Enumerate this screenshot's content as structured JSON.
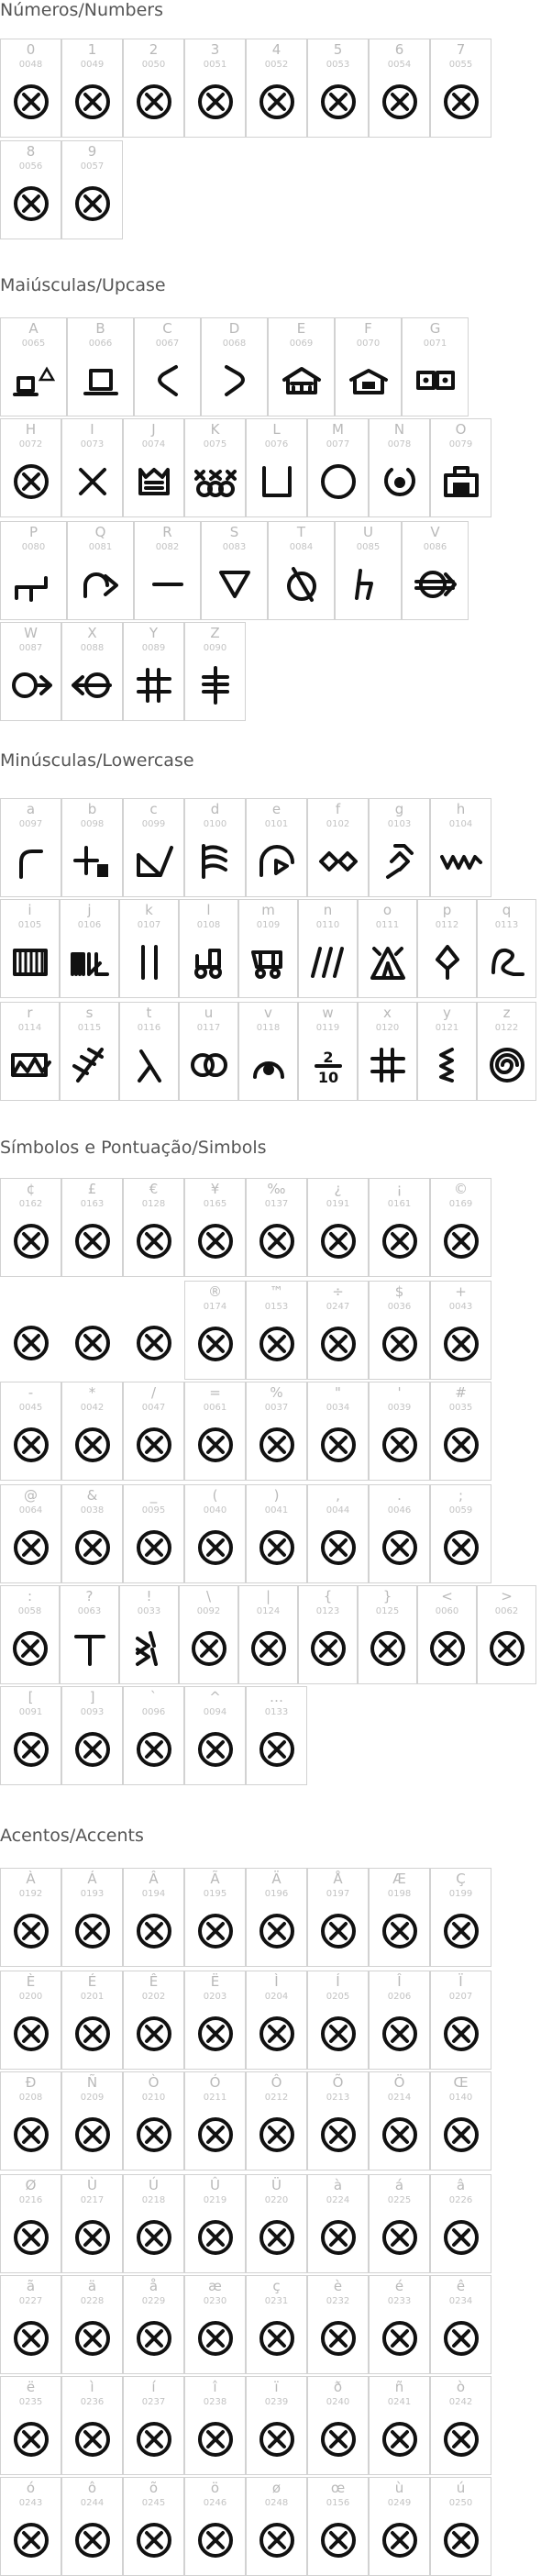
{
  "colors": {
    "border": "#d2d2d2",
    "glyph": "#111111",
    "label": "#b9b9b9",
    "title": "#555555"
  },
  "sections": [
    {
      "title": "Números/Numbers",
      "rows": [
        [
          {
            "ch": "0",
            "code": "0048",
            "g": "x"
          },
          {
            "ch": "1",
            "code": "0049",
            "g": "x"
          },
          {
            "ch": "2",
            "code": "0050",
            "g": "x"
          },
          {
            "ch": "3",
            "code": "0051",
            "g": "x"
          },
          {
            "ch": "4",
            "code": "0052",
            "g": "x"
          },
          {
            "ch": "5",
            "code": "0053",
            "g": "x"
          },
          {
            "ch": "6",
            "code": "0054",
            "g": "x"
          },
          {
            "ch": "7",
            "code": "0055",
            "g": "x"
          }
        ],
        [
          {
            "ch": "8",
            "code": "0056",
            "g": "x"
          },
          {
            "ch": "9",
            "code": "0057",
            "g": "x"
          }
        ]
      ]
    },
    {
      "title": "Maiúsculas/Upcase",
      "rows": [
        [
          {
            "ch": "A",
            "code": "0065",
            "g": "computer-triangle"
          },
          {
            "ch": "B",
            "code": "0066",
            "g": "computer"
          },
          {
            "ch": "C",
            "code": "0067",
            "g": "c-hook"
          },
          {
            "ch": "D",
            "code": "0068",
            "g": "d-hook"
          },
          {
            "ch": "E",
            "code": "0069",
            "g": "house-stripes"
          },
          {
            "ch": "F",
            "code": "0070",
            "g": "house-box"
          },
          {
            "ch": "G",
            "code": "0071",
            "g": "dot-boxes"
          }
        ],
        [
          {
            "ch": "H",
            "code": "0072",
            "g": "x"
          },
          {
            "ch": "I",
            "code": "0073",
            "g": "cross"
          },
          {
            "ch": "J",
            "code": "0074",
            "g": "crown"
          },
          {
            "ch": "K",
            "code": "0075",
            "g": "xoxo"
          },
          {
            "ch": "L",
            "code": "0076",
            "g": "cup"
          },
          {
            "ch": "M",
            "code": "0077",
            "g": "circle"
          },
          {
            "ch": "N",
            "code": "0078",
            "g": "target-notch"
          },
          {
            "ch": "O",
            "code": "0079",
            "g": "oven"
          }
        ],
        [
          {
            "ch": "P",
            "code": "0080",
            "g": "step"
          },
          {
            "ch": "Q",
            "code": "0081",
            "g": "arc-arrow"
          },
          {
            "ch": "R",
            "code": "0082",
            "g": "dash"
          },
          {
            "ch": "S",
            "code": "0083",
            "g": "triangle-down"
          },
          {
            "ch": "T",
            "code": "0084",
            "g": "slashed-circle"
          },
          {
            "ch": "U",
            "code": "0085",
            "g": "h-slash"
          },
          {
            "ch": "V",
            "code": "0086",
            "g": "circle-arrows"
          }
        ],
        [
          {
            "ch": "W",
            "code": "0087",
            "g": "circle-arrow-right"
          },
          {
            "ch": "X",
            "code": "0088",
            "g": "circle-arrow-left"
          },
          {
            "ch": "Y",
            "code": "0089",
            "g": "hash"
          },
          {
            "ch": "Z",
            "code": "0090",
            "g": "ladder"
          }
        ]
      ]
    },
    {
      "title": "Minúsculas/Lowercase",
      "rows": [
        [
          {
            "ch": "a",
            "code": "0097",
            "g": "hook-r"
          },
          {
            "ch": "b",
            "code": "0098",
            "g": "plus-block"
          },
          {
            "ch": "c",
            "code": "0099",
            "g": "checkbox-slash"
          },
          {
            "ch": "d",
            "code": "0100",
            "g": "flag-wave"
          },
          {
            "ch": "e",
            "code": "0101",
            "g": "dome-play"
          },
          {
            "ch": "f",
            "code": "0102",
            "g": "double-diamond"
          },
          {
            "ch": "g",
            "code": "0103",
            "g": "diamond-hook"
          },
          {
            "ch": "h",
            "code": "0104",
            "g": "zigzag"
          }
        ],
        [
          {
            "ch": "i",
            "code": "0105",
            "g": "piano"
          },
          {
            "ch": "j",
            "code": "0106",
            "g": "bars-check"
          },
          {
            "ch": "k",
            "code": "0107",
            "g": "double-bar"
          },
          {
            "ch": "l",
            "code": "0108",
            "g": "tractor"
          },
          {
            "ch": "m",
            "code": "0109",
            "g": "cart"
          },
          {
            "ch": "n",
            "code": "0110",
            "g": "slashes"
          },
          {
            "ch": "o",
            "code": "0111",
            "g": "tent"
          },
          {
            "ch": "p",
            "code": "0112",
            "g": "diamond-stem"
          },
          {
            "ch": "q",
            "code": "0113",
            "g": "swirl"
          }
        ],
        [
          {
            "ch": "r",
            "code": "0114",
            "g": "wave-box"
          },
          {
            "ch": "s",
            "code": "0115",
            "g": "track"
          },
          {
            "ch": "t",
            "code": "0116",
            "g": "lambda"
          },
          {
            "ch": "u",
            "code": "0117",
            "g": "rings"
          },
          {
            "ch": "v",
            "code": "0118",
            "g": "dot-arc"
          },
          {
            "ch": "w",
            "code": "0119",
            "g": "fraction"
          },
          {
            "ch": "x",
            "code": "0120",
            "g": "hash"
          },
          {
            "ch": "y",
            "code": "0121",
            "g": "squiggle"
          },
          {
            "ch": "z",
            "code": "0122",
            "g": "spiral"
          }
        ]
      ]
    },
    {
      "title": "Símbolos e Pontuação/Simbols",
      "rows": [
        [
          {
            "ch": "¢",
            "code": "0162",
            "g": "x"
          },
          {
            "ch": "£",
            "code": "0163",
            "g": "x"
          },
          {
            "ch": "€",
            "code": "0128",
            "g": "x"
          },
          {
            "ch": "¥",
            "code": "0165",
            "g": "x"
          },
          {
            "ch": "‰",
            "code": "0137",
            "g": "x"
          },
          {
            "ch": "¿",
            "code": "0191",
            "g": "x"
          },
          {
            "ch": "¡",
            "code": "0161",
            "g": "x"
          },
          {
            "ch": "©",
            "code": "0169",
            "g": "x"
          }
        ],
        [
          {
            "ch": "",
            "code": "",
            "g": "blank"
          },
          {
            "ch": "",
            "code": "",
            "g": "blank"
          },
          {
            "ch": "",
            "code": "",
            "g": "blank"
          },
          {
            "ch": "®",
            "code": "0174",
            "g": "x"
          },
          {
            "ch": "™",
            "code": "0153",
            "g": "x"
          },
          {
            "ch": "÷",
            "code": "0247",
            "g": "x"
          },
          {
            "ch": "$",
            "code": "0036",
            "g": "x"
          },
          {
            "ch": "+",
            "code": "0043",
            "g": "x"
          }
        ],
        [
          {
            "ch": "-",
            "code": "0045",
            "g": "x"
          },
          {
            "ch": "*",
            "code": "0042",
            "g": "x"
          },
          {
            "ch": "/",
            "code": "0047",
            "g": "x"
          },
          {
            "ch": "=",
            "code": "0061",
            "g": "x"
          },
          {
            "ch": "%",
            "code": "0037",
            "g": "x"
          },
          {
            "ch": "\"",
            "code": "0034",
            "g": "x"
          },
          {
            "ch": "'",
            "code": "0039",
            "g": "x"
          },
          {
            "ch": "#",
            "code": "0035",
            "g": "x"
          }
        ],
        [
          {
            "ch": "@",
            "code": "0064",
            "g": "x"
          },
          {
            "ch": "&",
            "code": "0038",
            "g": "x"
          },
          {
            "ch": "_",
            "code": "0095",
            "g": "x"
          },
          {
            "ch": "(",
            "code": "0040",
            "g": "x"
          },
          {
            "ch": ")",
            "code": "0041",
            "g": "x"
          },
          {
            "ch": ",",
            "code": "0044",
            "g": "x"
          },
          {
            "ch": ".",
            "code": "0046",
            "g": "x"
          },
          {
            "ch": ";",
            "code": "0059",
            "g": "x"
          }
        ],
        [
          {
            "ch": ":",
            "code": "0058",
            "g": "x"
          },
          {
            "ch": "?",
            "code": "0063",
            "g": "t-block"
          },
          {
            "ch": "!",
            "code": "0033",
            "g": "arrow-stack"
          },
          {
            "ch": "\\",
            "code": "0092",
            "g": "x"
          },
          {
            "ch": "|",
            "code": "0124",
            "g": "x"
          },
          {
            "ch": "{",
            "code": "0123",
            "g": "x"
          },
          {
            "ch": "}",
            "code": "0125",
            "g": "x"
          },
          {
            "ch": "<",
            "code": "0060",
            "g": "x"
          },
          {
            "ch": ">",
            "code": "0062",
            "g": "x"
          }
        ],
        [
          {
            "ch": "[",
            "code": "0091",
            "g": "x"
          },
          {
            "ch": "]",
            "code": "0093",
            "g": "x"
          },
          {
            "ch": "`",
            "code": "0096",
            "g": "x"
          },
          {
            "ch": "^",
            "code": "0094",
            "g": "x"
          },
          {
            "ch": "…",
            "code": "0133",
            "g": "x"
          }
        ]
      ]
    },
    {
      "title": "Acentos/Accents",
      "rows": [
        [
          {
            "ch": "À",
            "code": "0192",
            "g": "x"
          },
          {
            "ch": "Á",
            "code": "0193",
            "g": "x"
          },
          {
            "ch": "Â",
            "code": "0194",
            "g": "x"
          },
          {
            "ch": "Ã",
            "code": "0195",
            "g": "x"
          },
          {
            "ch": "Ä",
            "code": "0196",
            "g": "x"
          },
          {
            "ch": "Å",
            "code": "0197",
            "g": "x"
          },
          {
            "ch": "Æ",
            "code": "0198",
            "g": "x"
          },
          {
            "ch": "Ç",
            "code": "0199",
            "g": "x"
          }
        ],
        [
          {
            "ch": "È",
            "code": "0200",
            "g": "x"
          },
          {
            "ch": "É",
            "code": "0201",
            "g": "x"
          },
          {
            "ch": "Ê",
            "code": "0202",
            "g": "x"
          },
          {
            "ch": "Ë",
            "code": "0203",
            "g": "x"
          },
          {
            "ch": "Ì",
            "code": "0204",
            "g": "x"
          },
          {
            "ch": "Í",
            "code": "0205",
            "g": "x"
          },
          {
            "ch": "Î",
            "code": "0206",
            "g": "x"
          },
          {
            "ch": "Ï",
            "code": "0207",
            "g": "x"
          }
        ],
        [
          {
            "ch": "Ð",
            "code": "0208",
            "g": "x"
          },
          {
            "ch": "Ñ",
            "code": "0209",
            "g": "x"
          },
          {
            "ch": "Ò",
            "code": "0210",
            "g": "x"
          },
          {
            "ch": "Ó",
            "code": "0211",
            "g": "x"
          },
          {
            "ch": "Ô",
            "code": "0212",
            "g": "x"
          },
          {
            "ch": "Õ",
            "code": "0213",
            "g": "x"
          },
          {
            "ch": "Ö",
            "code": "0214",
            "g": "x"
          },
          {
            "ch": "Œ",
            "code": "0140",
            "g": "x"
          }
        ],
        [
          {
            "ch": "Ø",
            "code": "0216",
            "g": "x"
          },
          {
            "ch": "Ù",
            "code": "0217",
            "g": "x"
          },
          {
            "ch": "Ú",
            "code": "0218",
            "g": "x"
          },
          {
            "ch": "Û",
            "code": "0219",
            "g": "x"
          },
          {
            "ch": "Ü",
            "code": "0220",
            "g": "x"
          },
          {
            "ch": "à",
            "code": "0224",
            "g": "x"
          },
          {
            "ch": "á",
            "code": "0225",
            "g": "x"
          },
          {
            "ch": "â",
            "code": "0226",
            "g": "x"
          }
        ],
        [
          {
            "ch": "ã",
            "code": "0227",
            "g": "x"
          },
          {
            "ch": "ä",
            "code": "0228",
            "g": "x"
          },
          {
            "ch": "å",
            "code": "0229",
            "g": "x"
          },
          {
            "ch": "æ",
            "code": "0230",
            "g": "x"
          },
          {
            "ch": "ç",
            "code": "0231",
            "g": "x"
          },
          {
            "ch": "è",
            "code": "0232",
            "g": "x"
          },
          {
            "ch": "é",
            "code": "0233",
            "g": "x"
          },
          {
            "ch": "ê",
            "code": "0234",
            "g": "x"
          }
        ],
        [
          {
            "ch": "ë",
            "code": "0235",
            "g": "x"
          },
          {
            "ch": "ì",
            "code": "0236",
            "g": "x"
          },
          {
            "ch": "í",
            "code": "0237",
            "g": "x"
          },
          {
            "ch": "î",
            "code": "0238",
            "g": "x"
          },
          {
            "ch": "ï",
            "code": "0239",
            "g": "x"
          },
          {
            "ch": "ð",
            "code": "0240",
            "g": "x"
          },
          {
            "ch": "ñ",
            "code": "0241",
            "g": "x"
          },
          {
            "ch": "ò",
            "code": "0242",
            "g": "x"
          }
        ],
        [
          {
            "ch": "ó",
            "code": "0243",
            "g": "x"
          },
          {
            "ch": "ô",
            "code": "0244",
            "g": "x"
          },
          {
            "ch": "õ",
            "code": "0245",
            "g": "x"
          },
          {
            "ch": "ö",
            "code": "0246",
            "g": "x"
          },
          {
            "ch": "ø",
            "code": "0248",
            "g": "x"
          },
          {
            "ch": "œ",
            "code": "0156",
            "g": "x"
          },
          {
            "ch": "ù",
            "code": "0249",
            "g": "x"
          },
          {
            "ch": "ú",
            "code": "0250",
            "g": "x"
          }
        ]
      ]
    }
  ]
}
